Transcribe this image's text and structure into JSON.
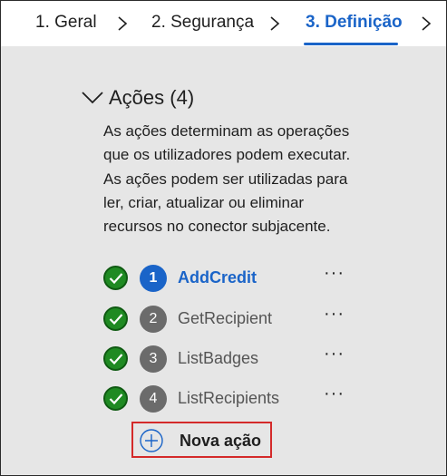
{
  "tabs": [
    {
      "label": "1. Geral"
    },
    {
      "label": "2. Segurança"
    },
    {
      "label": "3. Definição",
      "active": true
    }
  ],
  "section": {
    "title": "Ações (4)",
    "description": "As ações determinam as operações que os utilizadores podem executar. As ações podem ser utilizadas para ler, criar, atualizar ou eliminar recursos no conector subjacente."
  },
  "actions": [
    {
      "number": "1",
      "name": "AddCredit",
      "status": "valid",
      "active": true,
      "menu": "···"
    },
    {
      "number": "2",
      "name": "GetRecipient",
      "status": "valid",
      "menu": "···"
    },
    {
      "number": "3",
      "name": "ListBadges",
      "status": "valid",
      "menu": "···"
    },
    {
      "number": "4",
      "name": "ListRecipients",
      "status": "valid",
      "menu": "···"
    }
  ],
  "new_action": {
    "label": "Nova ação"
  },
  "colors": {
    "accent": "#1a64c8",
    "success": "#1f8a22",
    "highlight_border": "#d42a2a",
    "panel_bg": "#e6e6e6"
  },
  "icons": {
    "tab_separator": "chevron-right-icon",
    "section_toggle": "chevron-down-icon",
    "status": "checkmark-circle-icon",
    "menu": "more-horizontal-icon",
    "add": "plus-circle-icon"
  }
}
